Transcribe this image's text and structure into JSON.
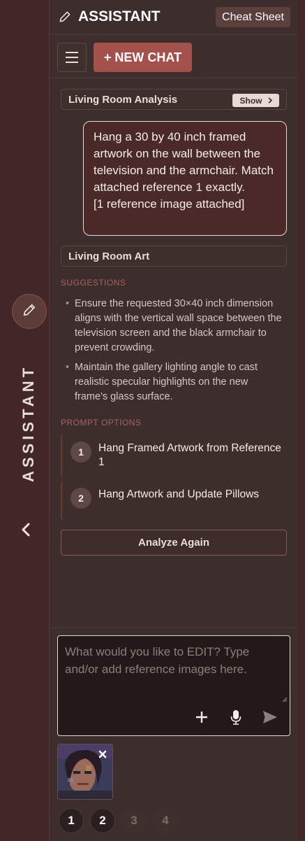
{
  "rail": {
    "title": "ASSISTANT",
    "icons": [
      "pencil-icon",
      "chevron-left-icon"
    ]
  },
  "header": {
    "title": "ASSISTANT",
    "cheat_sheet_label": "Cheat Sheet"
  },
  "toolbar": {
    "new_chat_label": "+ NEW CHAT"
  },
  "analysis": {
    "title": "Living Room Analysis",
    "show_label": "Show"
  },
  "message": {
    "text": "Hang a 30 by 40 inch framed artwork on the wall between the television and the armchair. Match attached reference 1 exactly.",
    "attachment_note": "[1 reference image attached]"
  },
  "art_section": {
    "title": "Living Room Art"
  },
  "suggestions": {
    "heading": "SUGGESTIONS",
    "items": [
      "Ensure the requested 30×40 inch dimension aligns with the vertical wall space between the television screen and the black armchair to prevent crowding.",
      "Maintain the gallery lighting angle to cast realistic specular highlights on the new frame's glass surface."
    ]
  },
  "prompt_options": {
    "heading": "PROMPT OPTIONS",
    "items": [
      {
        "number": "1",
        "label": "Hang Framed Artwork from Reference 1"
      },
      {
        "number": "2",
        "label": "Hang Artwork and Update Pillows"
      }
    ]
  },
  "analyze_again_label": "Analyze Again",
  "composer": {
    "placeholder": "What would you like to EDIT? Type and/or add reference images here.",
    "value": ""
  },
  "pagination": [
    "1",
    "2",
    "3",
    "4"
  ],
  "colors": {
    "accent": "#a4504b",
    "panel_bg": "#3b2e2c",
    "rail_bg": "#432727"
  }
}
